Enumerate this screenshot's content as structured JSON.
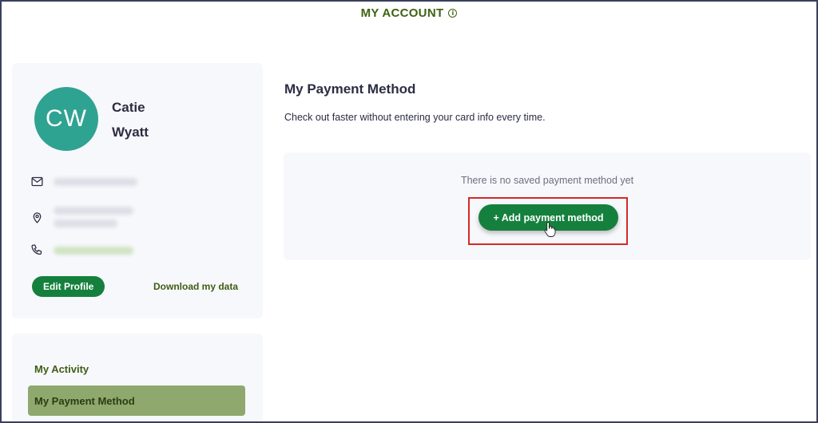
{
  "header": {
    "title": "MY ACCOUNT",
    "info_icon": "info-icon"
  },
  "profile": {
    "initials": "CW",
    "first_name": "Catie",
    "last_name": "Wyatt",
    "avatar_color": "#2fa391",
    "icons": [
      "mail-icon",
      "location-pin-icon",
      "phone-icon"
    ],
    "edit_label": "Edit Profile",
    "download_label": "Download my data"
  },
  "nav": {
    "items": [
      {
        "label": "My Activity",
        "active": false
      },
      {
        "label": "My Payment Method",
        "active": true
      }
    ]
  },
  "main": {
    "title": "My Payment Method",
    "description": "Check out faster without entering your card info every time.",
    "empty_text": "There is no saved payment method yet",
    "add_button_label": "+ Add payment method"
  },
  "colors": {
    "brand_green": "#15803d",
    "header_green": "#3f6212",
    "highlight_red": "#d42a2a",
    "active_nav": "#8fa86e"
  }
}
